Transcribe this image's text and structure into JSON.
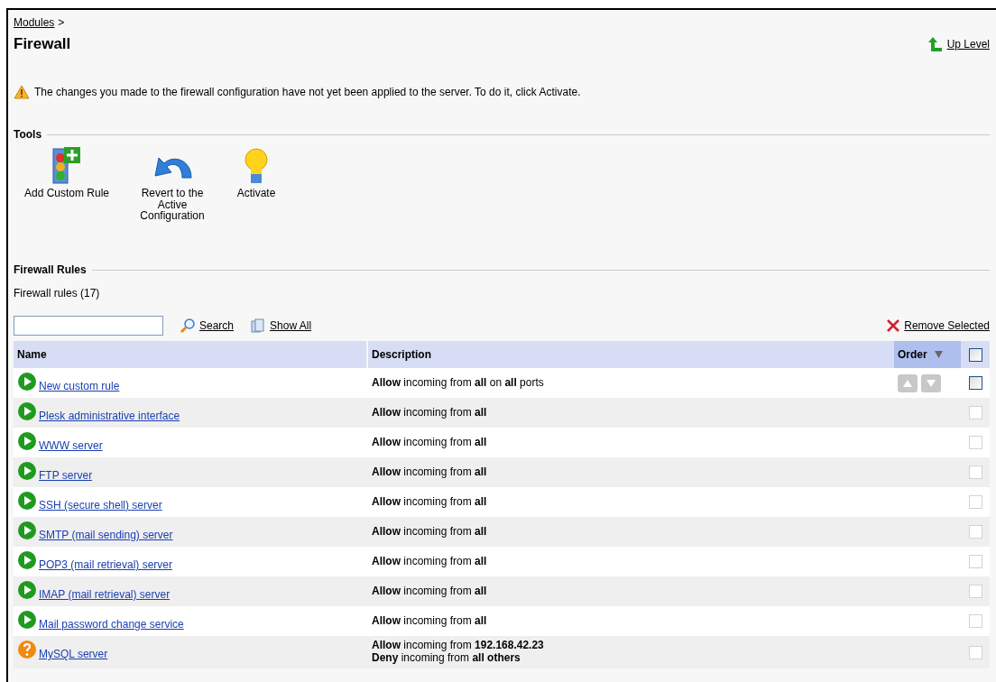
{
  "breadcrumb": {
    "link": "Modules",
    "separator": ">"
  },
  "title": "Firewall",
  "up_level": "Up Level",
  "warning": "The changes you made to the firewall configuration have not yet been applied to the server. To do it, click Activate.",
  "tools": {
    "heading": "Tools",
    "items": [
      {
        "kind": "add-rule",
        "label": "Add Custom Rule"
      },
      {
        "kind": "revert",
        "label": "Revert to the Active Configuration"
      },
      {
        "kind": "activate",
        "label": "Activate"
      }
    ]
  },
  "rules": {
    "heading": "Firewall Rules",
    "count": "Firewall rules (17)",
    "search_button": "Search",
    "show_all": "Show All",
    "remove_selected": "Remove Selected",
    "columns": [
      "Name",
      "Description",
      "Order"
    ],
    "header_checked": false,
    "rows": [
      {
        "kind": "on",
        "name": "New custom rule",
        "description": [
          "**Allow** incoming from **all** on **all** ports"
        ],
        "order_arrows": true,
        "checkbox_enabled": true,
        "checked": false
      },
      {
        "kind": "on",
        "name": "Plesk administrative interface",
        "description": [
          "**Allow** incoming from **all**"
        ],
        "order_arrows": false,
        "checkbox_enabled": false,
        "checked": false
      },
      {
        "kind": "on",
        "name": "WWW server",
        "description": [
          "**Allow** incoming from **all**"
        ],
        "order_arrows": false,
        "checkbox_enabled": false,
        "checked": false
      },
      {
        "kind": "on",
        "name": "FTP server",
        "description": [
          "**Allow** incoming from **all**"
        ],
        "order_arrows": false,
        "checkbox_enabled": false,
        "checked": false
      },
      {
        "kind": "on",
        "name": "SSH (secure shell) server",
        "description": [
          "**Allow** incoming from **all**"
        ],
        "order_arrows": false,
        "checkbox_enabled": false,
        "checked": false
      },
      {
        "kind": "on",
        "name": "SMTP (mail sending) server",
        "description": [
          "**Allow** incoming from **all**"
        ],
        "order_arrows": false,
        "checkbox_enabled": false,
        "checked": false
      },
      {
        "kind": "on",
        "name": "POP3 (mail retrieval) server",
        "description": [
          "**Allow** incoming from **all**"
        ],
        "order_arrows": false,
        "checkbox_enabled": false,
        "checked": false
      },
      {
        "kind": "on",
        "name": "IMAP (mail retrieval) server",
        "description": [
          "**Allow** incoming from **all**"
        ],
        "order_arrows": false,
        "checkbox_enabled": false,
        "checked": false
      },
      {
        "kind": "on",
        "name": "Mail password change service",
        "description": [
          "**Allow** incoming from **all**"
        ],
        "order_arrows": false,
        "checkbox_enabled": false,
        "checked": false
      },
      {
        "kind": "partial",
        "name": "MySQL server",
        "description": [
          "**Allow** incoming from **192.168.42.23**",
          "**Deny** incoming from **all others**"
        ],
        "order_arrows": false,
        "checkbox_enabled": false,
        "checked": false
      }
    ]
  }
}
